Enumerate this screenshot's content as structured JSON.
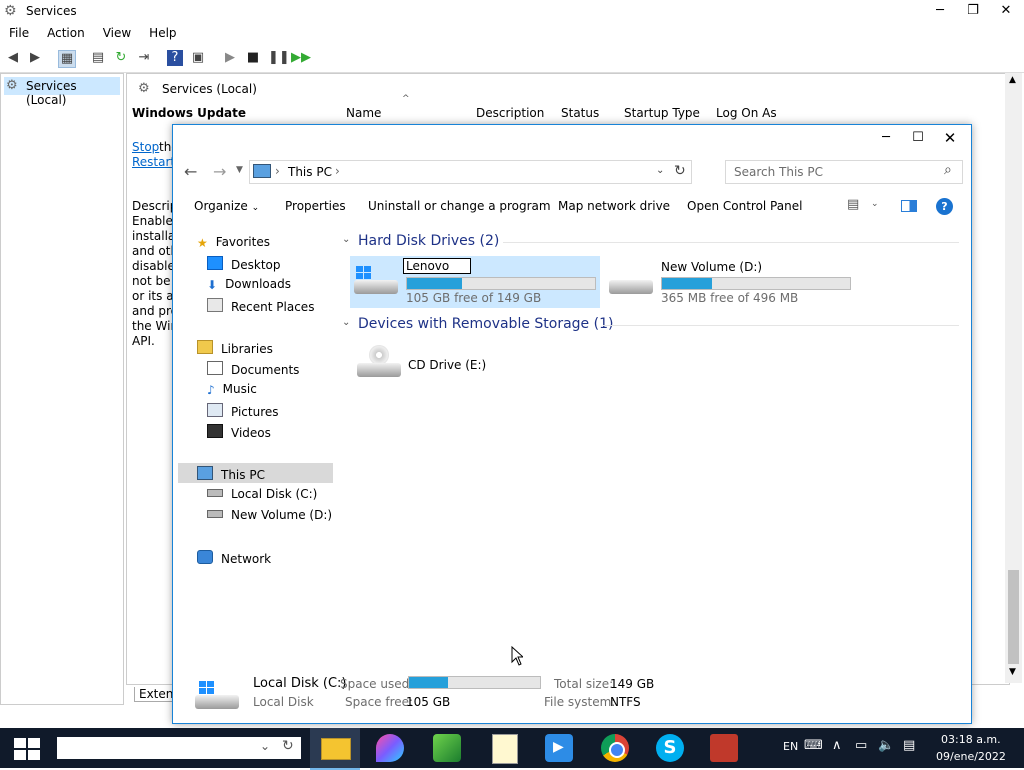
{
  "services_window": {
    "title": "Services",
    "menu": [
      "File",
      "Action",
      "View",
      "Help"
    ],
    "tree_root": "Services (Local)",
    "header_title": "Services (Local)",
    "selected_service": "Windows Update",
    "link_stop": "Stop",
    "link_stop_suffix": "the",
    "link_restart": "Restart",
    "description_lines": [
      "Descript",
      "Enables",
      "installat",
      "and oth",
      "disabled",
      "not be a",
      "or its au",
      "and pro",
      "the Win",
      "API."
    ],
    "columns": [
      "Name",
      "Description",
      "Status",
      "Startup Type",
      "Log On As"
    ],
    "bottom_tab": "Extend"
  },
  "explorer": {
    "address_location": "This PC",
    "search_placeholder": "Search This PC",
    "commands": [
      "Organize",
      "Properties",
      "Uninstall or change a program",
      "Map network drive",
      "Open Control Panel"
    ],
    "nav": {
      "favorites": "Favorites",
      "favorites_items": [
        "Desktop",
        "Downloads",
        "Recent Places"
      ],
      "libraries": "Libraries",
      "libraries_items": [
        "Documents",
        "Music",
        "Pictures",
        "Videos"
      ],
      "this_pc": "This PC",
      "this_pc_items": [
        "Local Disk (C:)",
        "New Volume (D:)"
      ],
      "network": "Network"
    },
    "groups": {
      "hard_disks": "Hard Disk Drives (2)",
      "removable": "Devices with Removable Storage (1)"
    },
    "drives": [
      {
        "rename_value": "Lenovo",
        "free_text": "105 GB free of 149 GB",
        "used_fraction": 0.295
      },
      {
        "name": "New Volume (D:)",
        "free_text": "365 MB free of 496 MB",
        "used_fraction": 0.264
      }
    ],
    "cd_drive": "CD Drive (E:)",
    "details": {
      "name": "Local Disk (C:)",
      "type": "Local Disk",
      "space_used_label": "Space used:",
      "space_free_label": "Space free:",
      "space_free": "105 GB",
      "total_size_label": "Total size:",
      "total_size": "149 GB",
      "file_system_label": "File system:",
      "file_system": "NTFS",
      "used_fraction": 0.295
    }
  },
  "taskbar": {
    "language": "EN",
    "time": "03:18 a.m.",
    "date": "09/ene/2022"
  },
  "colors": {
    "accent": "#1883d7",
    "bar_fill": "#26a0da",
    "taskbar_bg": "#101a2a",
    "selection": "#cce8ff"
  }
}
